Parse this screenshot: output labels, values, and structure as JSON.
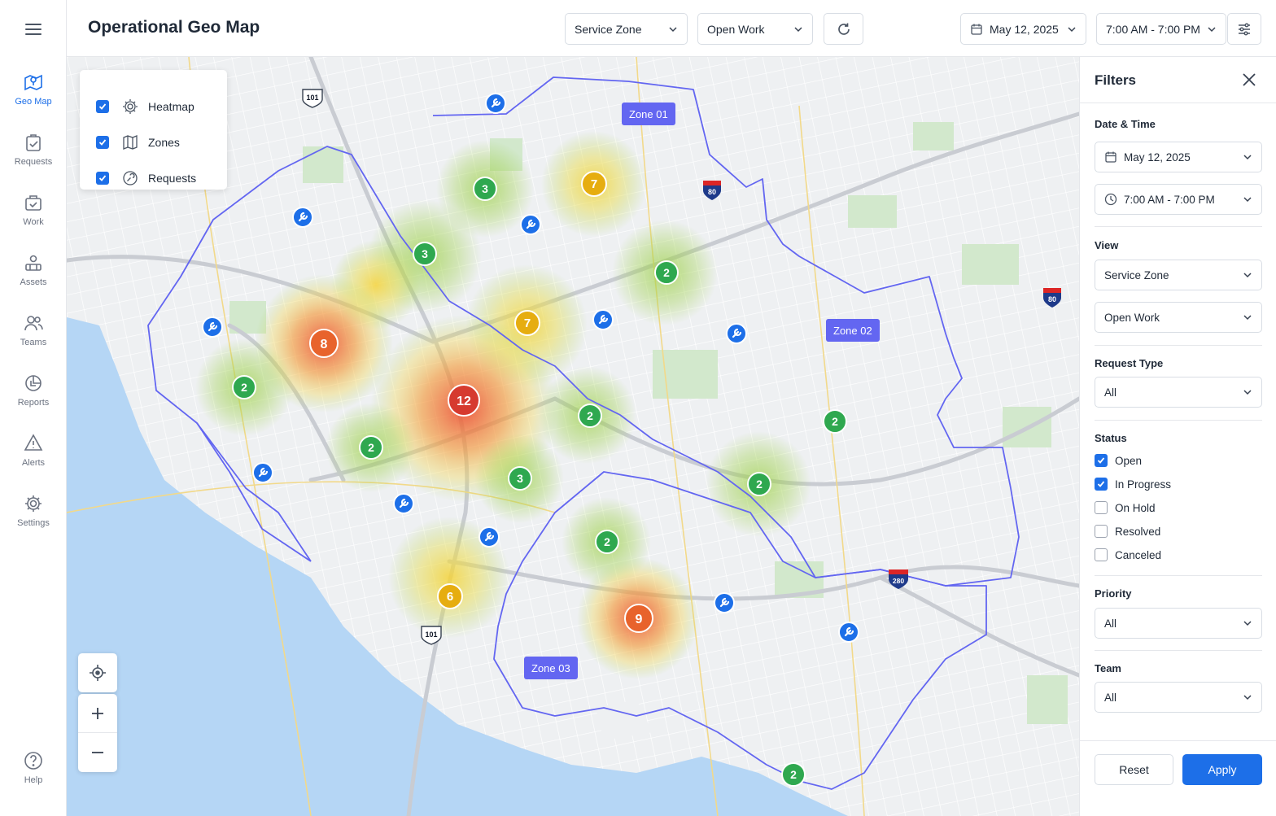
{
  "nav": {
    "items": [
      {
        "label": "Geo Map"
      },
      {
        "label": "Requests"
      },
      {
        "label": "Work"
      },
      {
        "label": "Assets"
      },
      {
        "label": "Teams"
      },
      {
        "label": "Reports"
      },
      {
        "label": "Alerts"
      },
      {
        "label": "Settings"
      }
    ],
    "help_label": "Help"
  },
  "header": {
    "title": "Operational Geo Map",
    "view_select": "Service Zone",
    "work_select": "Open Work",
    "date": "May 12, 2025",
    "time_range": "7:00 AM - 7:00 PM"
  },
  "layers": {
    "heatmap": "Heatmap",
    "zones": "Zones",
    "requests": "Requests"
  },
  "map": {
    "zones": [
      "Zone 01",
      "Zone 02",
      "Zone 03"
    ],
    "highways": [
      "101",
      "101",
      "80",
      "80",
      "280"
    ],
    "clusters": [
      {
        "count": "3",
        "level": "low"
      },
      {
        "count": "7",
        "level": "mid"
      },
      {
        "count": "3",
        "level": "low"
      },
      {
        "count": "2",
        "level": "low"
      },
      {
        "count": "7",
        "level": "mid"
      },
      {
        "count": "8",
        "level": "high"
      },
      {
        "count": "2",
        "level": "low"
      },
      {
        "count": "12",
        "level": "critical"
      },
      {
        "count": "2",
        "level": "low"
      },
      {
        "count": "2",
        "level": "low"
      },
      {
        "count": "2",
        "level": "low"
      },
      {
        "count": "3",
        "level": "low"
      },
      {
        "count": "2",
        "level": "low"
      },
      {
        "count": "2",
        "level": "low"
      },
      {
        "count": "6",
        "level": "mid"
      },
      {
        "count": "9",
        "level": "high"
      },
      {
        "count": "2",
        "level": "low"
      }
    ],
    "colors": {
      "low": "#2fa84f",
      "mid": "#e6ad10",
      "high": "#e8632c",
      "critical": "#d63a2f",
      "zone_border": "#6366f1",
      "request_pin": "#1d6fe8",
      "water": "#b5d6f5"
    }
  },
  "filters": {
    "title": "Filters",
    "date_time_label": "Date & Time",
    "date": "May 12, 2025",
    "time": "7:00 AM - 7:00 PM",
    "view_label": "View",
    "view": "Service Zone",
    "work": "Open Work",
    "request_type_label": "Request Type",
    "request_type": "All",
    "status_label": "Status",
    "statuses": [
      {
        "label": "Open",
        "checked": true
      },
      {
        "label": "In Progress",
        "checked": true
      },
      {
        "label": "On Hold",
        "checked": false
      },
      {
        "label": "Resolved",
        "checked": false
      },
      {
        "label": "Canceled",
        "checked": false
      }
    ],
    "priority_label": "Priority",
    "priority": "All",
    "team_label": "Team",
    "team": "All",
    "reset_label": "Reset",
    "apply_label": "Apply"
  }
}
